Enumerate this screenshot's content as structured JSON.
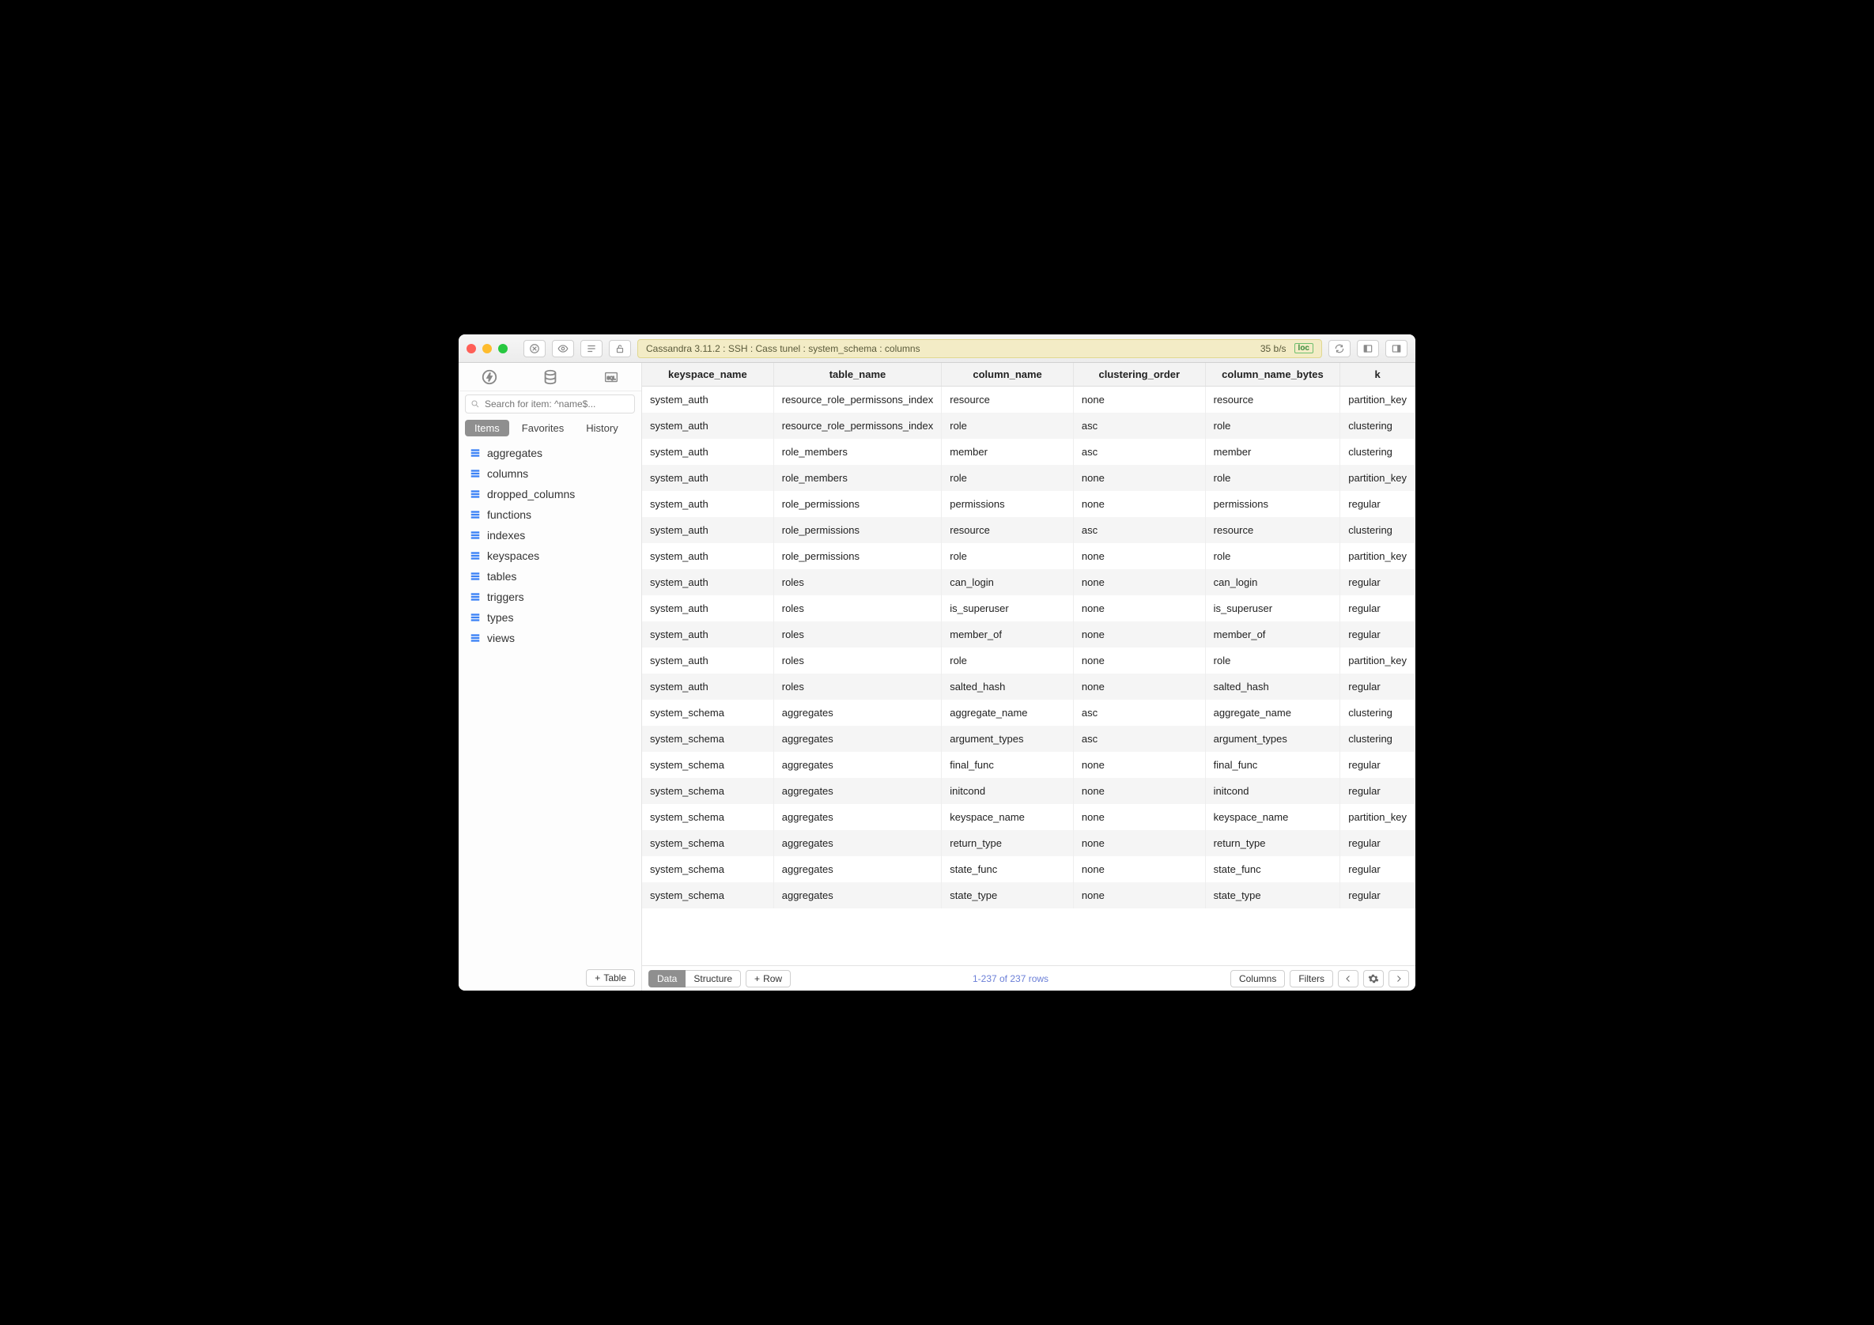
{
  "toolbar": {
    "breadcrumb": "Cassandra 3.11.2 : SSH : Cass tunel : system_schema : columns",
    "rate": "35 b/s",
    "loc_badge": "loc"
  },
  "sidebar": {
    "search_placeholder": "Search for item: ^name$...",
    "tabs": [
      {
        "label": "Items",
        "active": true
      },
      {
        "label": "Favorites",
        "active": false
      },
      {
        "label": "History",
        "active": false
      }
    ],
    "items": [
      {
        "label": "aggregates"
      },
      {
        "label": "columns"
      },
      {
        "label": "dropped_columns"
      },
      {
        "label": "functions"
      },
      {
        "label": "indexes"
      },
      {
        "label": "keyspaces"
      },
      {
        "label": "tables"
      },
      {
        "label": "triggers"
      },
      {
        "label": "types"
      },
      {
        "label": "views"
      }
    ],
    "add_table_label": "Table"
  },
  "table": {
    "columns": [
      "keyspace_name",
      "table_name",
      "column_name",
      "clustering_order",
      "column_name_bytes",
      "k"
    ],
    "rows": [
      [
        "system_auth",
        "resource_role_permissons_index",
        "resource",
        "none",
        "resource",
        "partition_key"
      ],
      [
        "system_auth",
        "resource_role_permissons_index",
        "role",
        "asc",
        "role",
        "clustering"
      ],
      [
        "system_auth",
        "role_members",
        "member",
        "asc",
        "member",
        "clustering"
      ],
      [
        "system_auth",
        "role_members",
        "role",
        "none",
        "role",
        "partition_key"
      ],
      [
        "system_auth",
        "role_permissions",
        "permissions",
        "none",
        "permissions",
        "regular"
      ],
      [
        "system_auth",
        "role_permissions",
        "resource",
        "asc",
        "resource",
        "clustering"
      ],
      [
        "system_auth",
        "role_permissions",
        "role",
        "none",
        "role",
        "partition_key"
      ],
      [
        "system_auth",
        "roles",
        "can_login",
        "none",
        "can_login",
        "regular"
      ],
      [
        "system_auth",
        "roles",
        "is_superuser",
        "none",
        "is_superuser",
        "regular"
      ],
      [
        "system_auth",
        "roles",
        "member_of",
        "none",
        "member_of",
        "regular"
      ],
      [
        "system_auth",
        "roles",
        "role",
        "none",
        "role",
        "partition_key"
      ],
      [
        "system_auth",
        "roles",
        "salted_hash",
        "none",
        "salted_hash",
        "regular"
      ],
      [
        "system_schema",
        "aggregates",
        "aggregate_name",
        "asc",
        "aggregate_name",
        "clustering"
      ],
      [
        "system_schema",
        "aggregates",
        "argument_types",
        "asc",
        "argument_types",
        "clustering"
      ],
      [
        "system_schema",
        "aggregates",
        "final_func",
        "none",
        "final_func",
        "regular"
      ],
      [
        "system_schema",
        "aggregates",
        "initcond",
        "none",
        "initcond",
        "regular"
      ],
      [
        "system_schema",
        "aggregates",
        "keyspace_name",
        "none",
        "keyspace_name",
        "partition_key"
      ],
      [
        "system_schema",
        "aggregates",
        "return_type",
        "none",
        "return_type",
        "regular"
      ],
      [
        "system_schema",
        "aggregates",
        "state_func",
        "none",
        "state_func",
        "regular"
      ],
      [
        "system_schema",
        "aggregates",
        "state_type",
        "none",
        "state_type",
        "regular"
      ]
    ]
  },
  "footer": {
    "seg": [
      {
        "label": "Data",
        "active": true
      },
      {
        "label": "Structure",
        "active": false
      }
    ],
    "add_row_label": "Row",
    "status": "1-237 of 237 rows",
    "columns_btn": "Columns",
    "filters_btn": "Filters"
  }
}
